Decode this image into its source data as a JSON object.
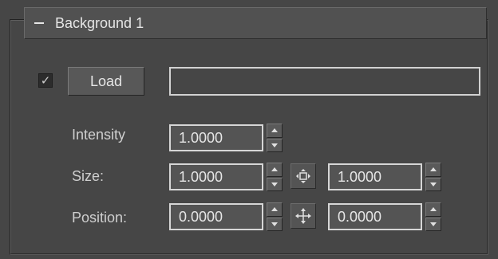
{
  "rollout": {
    "title": "Background 1",
    "collapse_icon": "minus-icon"
  },
  "load": {
    "checked": true,
    "button_label": "Load",
    "path_value": ""
  },
  "intensity": {
    "label": "Intensity",
    "value": "1.0000"
  },
  "size": {
    "label": "Size:",
    "x": "1.0000",
    "y": "1.0000",
    "lock_icon": "scale-lock-icon"
  },
  "position": {
    "label": "Position:",
    "x": "0.0000",
    "y": "0.0000",
    "lock_icon": "move-lock-icon"
  },
  "colors": {
    "background": "#464646",
    "field_border": "#d6d6d6",
    "text": "#e6e6e6"
  }
}
